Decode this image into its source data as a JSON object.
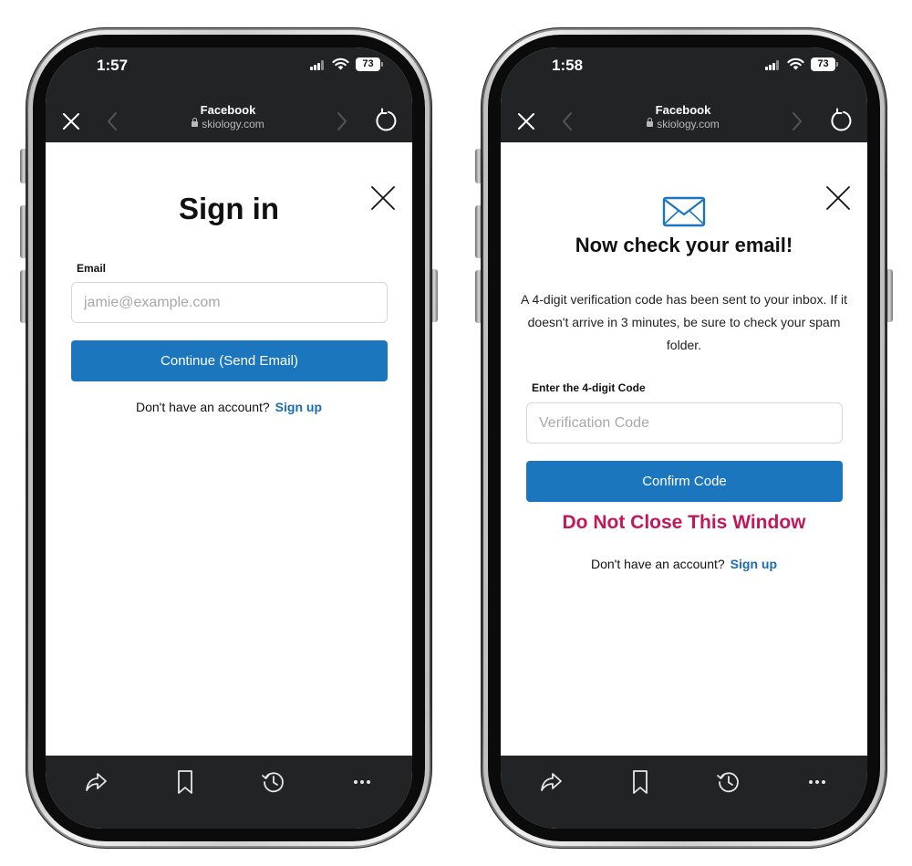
{
  "phones": [
    {
      "status": {
        "time": "1:57",
        "battery": "73"
      },
      "browser": {
        "title": "Facebook",
        "domain": "skiology.com"
      },
      "page": {
        "heading": "Sign in",
        "email_label": "Email",
        "email_placeholder": "jamie@example.com",
        "continue_label": "Continue (Send Email)",
        "no_account_text": "Don't have an account?",
        "signup_label": "Sign up"
      }
    },
    {
      "status": {
        "time": "1:58",
        "battery": "73"
      },
      "browser": {
        "title": "Facebook",
        "domain": "skiology.com"
      },
      "page": {
        "heading": "Now check your email!",
        "description": "A 4-digit verification code has been sent to your inbox. If it doesn't arrive in 3 minutes, be sure to check your spam folder.",
        "code_label": "Enter the 4-digit Code",
        "code_placeholder": "Verification Code",
        "confirm_label": "Confirm Code",
        "warning": "Do Not Close This Window",
        "no_account_text": "Don't have an account?",
        "signup_label": "Sign up"
      }
    }
  ],
  "toolbar_icons": [
    "share-icon",
    "bookmark-icon",
    "history-icon",
    "more-icon"
  ],
  "colors": {
    "primary": "#1b76bd",
    "link": "#1b6cb3",
    "warning": "#c0185a",
    "chrome": "#222325"
  }
}
